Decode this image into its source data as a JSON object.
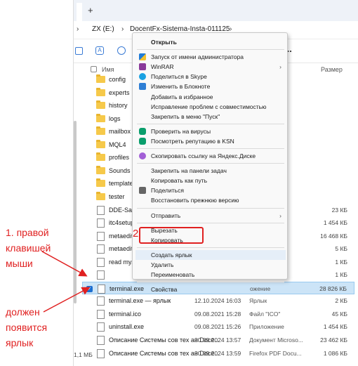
{
  "window": {
    "tab_plus": "+",
    "address": {
      "drive": "ZX (E:)",
      "folder": "DocentFx-Sistema-Insta-011125",
      "sep1": "›",
      "sep2": "›",
      "chevron": "›"
    },
    "toolbar": {
      "more": "..."
    },
    "columns": {
      "name": "Имя",
      "size": "Размер"
    },
    "status_size": "1,1 МБ"
  },
  "files": [
    {
      "name": "config",
      "kind": "folder",
      "date": "",
      "type": "файлами",
      "size": ""
    },
    {
      "name": "experts",
      "kind": "folder",
      "date": "",
      "type": "файлами",
      "size": ""
    },
    {
      "name": "history",
      "kind": "folder",
      "date": "",
      "type": "файлами",
      "size": ""
    },
    {
      "name": "logs",
      "kind": "folder",
      "date": "",
      "type": "файлами",
      "size": ""
    },
    {
      "name": "mailbox",
      "kind": "folder",
      "date": "",
      "type": "файлами",
      "size": ""
    },
    {
      "name": "MQL4",
      "kind": "folder",
      "date": "",
      "type": "файлами",
      "size": ""
    },
    {
      "name": "profiles",
      "kind": "folder",
      "date": "",
      "type": "файлами",
      "size": ""
    },
    {
      "name": "Sounds",
      "kind": "folder",
      "date": "",
      "type": "файлами",
      "size": ""
    },
    {
      "name": "templates",
      "kind": "folder",
      "date": "",
      "type": "файлами",
      "size": ""
    },
    {
      "name": "tester",
      "kind": "folder",
      "date": "",
      "type": "файлами",
      "size": ""
    },
    {
      "name": "DDE-Sample",
      "kind": "file",
      "date": "",
      "type": "rosoft Ex...",
      "size": "23 КБ"
    },
    {
      "name": "itc4setup.exe",
      "kind": "file",
      "date": "",
      "type": "",
      "size": "1 454 КБ"
    },
    {
      "name": "metaedito",
      "kind": "file",
      "date": "",
      "type": "",
      "size": "16 468 КБ"
    },
    {
      "name": "metaeditor.e",
      "kind": "file",
      "date": "",
      "type": "",
      "size": "5 КБ"
    },
    {
      "name": "read my.txt",
      "kind": "file",
      "date": "",
      "type": "док...",
      "size": "1 КБ"
    },
    {
      "name": "",
      "kind": "file",
      "date": "",
      "type": "",
      "size": "1 КБ"
    },
    {
      "name": "terminal.exe",
      "kind": "file",
      "date": "",
      "type": "ожение",
      "size": "28 826 КБ",
      "selected": true
    },
    {
      "name": "terminal.exe — ярлык",
      "kind": "file",
      "date": "12.10.2024 16:03",
      "type": "Ярлык",
      "size": "2 КБ"
    },
    {
      "name": "terminal.ico",
      "kind": "file",
      "date": "09.08.2021 15:28",
      "type": "Файл \"ICO\"",
      "size": "45 КБ"
    },
    {
      "name": "uninstall.exe",
      "kind": "file",
      "date": "09.08.2021 15:26",
      "type": "Приложение",
      "size": "1 454 КБ"
    },
    {
      "name": "Описание Системы сов тех ан Doce...",
      "kind": "file",
      "date": "30.09.2024 13:57",
      "type": "Документ Microso...",
      "size": "23 462 КБ"
    },
    {
      "name": "Описание Системы сов тех ан Doce...",
      "kind": "file",
      "date": "30.09.2024 13:59",
      "type": "Firefox PDF Docu...",
      "size": "1 086 КБ"
    }
  ],
  "context_menu": {
    "items": [
      {
        "label": "Открыть",
        "icon": "",
        "bold": true
      },
      {
        "label": "Запуск от имени администратора",
        "icon": "shield-icon"
      },
      {
        "label": "WinRAR",
        "icon": "winrar-icon",
        "submenu": "›"
      },
      {
        "label": "Поделиться в Skype",
        "icon": "skype-icon"
      },
      {
        "label": "Изменить в Блокноте",
        "icon": "notepad-icon"
      },
      {
        "label": "Добавить в избранное",
        "icon": ""
      },
      {
        "label": "Исправление проблем с совместимостью",
        "icon": ""
      },
      {
        "label": "Закрепить в меню \"Пуск\"",
        "icon": ""
      },
      {
        "label": "Проверить на вирусы",
        "icon": "kaspersky-icon"
      },
      {
        "label": "Посмотреть репутацию в KSN",
        "icon": "kaspersky-icon"
      },
      {
        "label": "Скопировать ссылку на Яндекс.Диске",
        "icon": "link-icon"
      },
      {
        "label": "Закрепить на панели задач",
        "icon": ""
      },
      {
        "label": "Копировать как путь",
        "icon": ""
      },
      {
        "label": "Поделиться",
        "icon": "share-icon"
      },
      {
        "label": "Восстановить прежнюю версию",
        "icon": ""
      },
      {
        "label": "Отправить",
        "icon": "",
        "submenu": "›"
      },
      {
        "label": "Вырезать",
        "icon": ""
      },
      {
        "label": "Копировать",
        "icon": ""
      },
      {
        "label": "Создать ярлык",
        "icon": "",
        "highlight": true
      },
      {
        "label": "Удалить",
        "icon": ""
      },
      {
        "label": "Переименовать",
        "icon": ""
      },
      {
        "label": "Свойства",
        "icon": ""
      }
    ]
  },
  "annotations": {
    "step1": [
      "1. правой",
      "клавишей",
      "мыши"
    ],
    "step2_marker": "2",
    "result": [
      "должен",
      "появится",
      "ярлык"
    ],
    "color": "#e02020"
  },
  "colors": {
    "selection": "#cce4f7",
    "folder": "#f6c94a",
    "menu_bg": "#f9f9f9"
  }
}
